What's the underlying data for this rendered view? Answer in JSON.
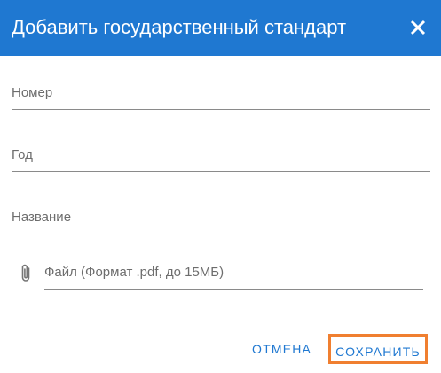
{
  "dialog": {
    "title": "Добавить государственный стандарт",
    "header_color": "#1f78d1",
    "close_icon": "close-icon"
  },
  "form": {
    "number": {
      "value": "",
      "placeholder": "Номер"
    },
    "year": {
      "value": "",
      "placeholder": "Год"
    },
    "name": {
      "value": "",
      "placeholder": "Название"
    },
    "file": {
      "value": "",
      "placeholder": "Файл (Формат .pdf, до 15МБ)",
      "icon": "paperclip-icon"
    }
  },
  "actions": {
    "cancel_label": "ОТМЕНА",
    "save_label": "СОХРАНИТЬ",
    "save_highlight_color": "#f07f30"
  }
}
